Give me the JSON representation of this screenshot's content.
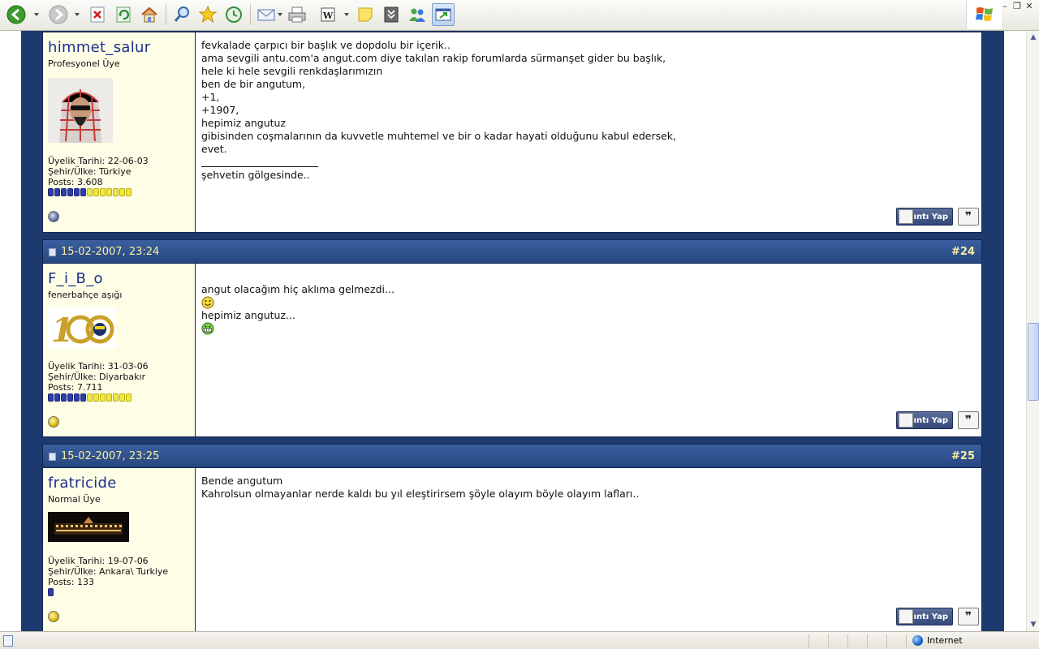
{
  "browser": {
    "status_zone": "Internet",
    "icons": [
      "back-icon",
      "forward-icon",
      "stop-icon",
      "refresh-icon",
      "home-icon",
      "search-icon",
      "favorites-icon",
      "history-icon",
      "mail-icon",
      "print-icon",
      "edit-word-icon",
      "note-icon",
      "research-icon",
      "messenger-icon",
      "window-icon"
    ]
  },
  "posts": [
    {
      "date": "",
      "number": "",
      "username": "himmet_salur",
      "user_title": "Profesyonel Üye",
      "join_label": "Üyelik Tarihi: 22-06-03",
      "location_label": "Şehir/Ülke: Türkiye",
      "posts_label": "Posts: 3.608",
      "reputation": {
        "blue": 6,
        "yellow": 7
      },
      "online": false,
      "message": "fevkalade çarpıcı bir başlık ve dopdolu bir içerik..\nama sevgili antu.com'a angut.com diye takılan rakip forumlarda sürmanşet gider bu başlık,\nhele ki hele sevgili renkdaşlarımızın\nben de bir angutum,\n+1,\n+1907,\nhepimiz angutuz\ngibisinden coşmalarının da kuvvetle muhtemel ve bir o kadar hayati olduğunu kabul edersek,\nevet.",
      "signature": "şehvetin gölgesinde..",
      "quote_label": "Alıntı Yap"
    },
    {
      "date": "15-02-2007, 23:24",
      "number": "#24",
      "username": "F_i_B_o",
      "user_title": "fenerbahçe aşığı",
      "join_label": "Üyelik Tarihi: 31-03-06",
      "location_label": "Şehir/Ülke: Diyarbakır",
      "posts_label": "Posts: 7.711",
      "reputation": {
        "blue": 6,
        "yellow": 7
      },
      "online": true,
      "message_line1": "angut olacağım hiç aklıma gelmezdi...",
      "message_line2": "hepimiz angutuz...",
      "quote_label": "Alıntı Yap"
    },
    {
      "date": "15-02-2007, 23:25",
      "number": "#25",
      "username": "fratricide",
      "user_title": "Normal Üye",
      "join_label": "Üyelik Tarihi: 19-07-06",
      "location_label": "Şehir/Ülke: Ankara\\ Turkiye",
      "posts_label": "Posts: 133",
      "reputation": {
        "blue": 1,
        "yellow": 0
      },
      "online": true,
      "message": "Bende angutum\nKahrolsun olmayanlar nerde kaldı bu yıl eleştirirsem şöyle olayım böyle olayım lafları..",
      "quote_label": "Alıntı Yap"
    }
  ]
}
